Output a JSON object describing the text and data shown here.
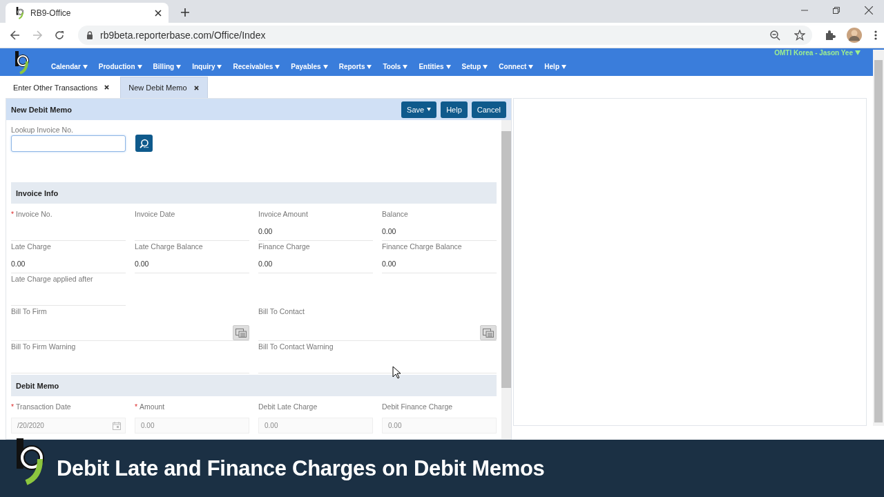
{
  "browser": {
    "tab_title": "RB9-Office",
    "url": "rb9beta.reporterbase.com/Office/Index"
  },
  "app": {
    "user_menu": "OMTI Korea - Jason Yee",
    "menu": [
      "Calendar",
      "Production",
      "Billing",
      "Inquiry",
      "Receivables",
      "Payables",
      "Reports",
      "Tools",
      "Entities",
      "Setup",
      "Connect",
      "Help"
    ],
    "tabs": [
      {
        "label": "Enter Other Transactions",
        "selected": false
      },
      {
        "label": "New Debit Memo",
        "selected": true
      }
    ]
  },
  "form": {
    "title": "New Debit Memo",
    "buttons": [
      {
        "label": "Save",
        "kind": "dropdown"
      },
      {
        "label": "Help",
        "kind": "plain"
      },
      {
        "label": "Cancel",
        "kind": "plain"
      }
    ],
    "lookup": {
      "label": "Lookup Invoice No."
    },
    "required_mark": "*",
    "sections": [
      {
        "title": "Invoice Info",
        "fields": [
          {
            "label": "Invoice No.",
            "required": true,
            "kind": "text"
          },
          {
            "label": "Invoice Date",
            "required": false,
            "kind": "text"
          },
          {
            "label": "Invoice Amount",
            "required": false,
            "kind": "text",
            "value": "0.00"
          },
          {
            "label": "Balance",
            "required": false,
            "kind": "text",
            "value": "0.00"
          },
          {
            "label": "Late Charge",
            "required": false,
            "kind": "text",
            "value": "0.00"
          },
          {
            "label": "Late Charge Balance",
            "required": false,
            "kind": "text",
            "value": "0.00"
          },
          {
            "label": "Finance Charge",
            "required": false,
            "kind": "text",
            "value": "0.00"
          },
          {
            "label": "Finance Charge Balance",
            "required": false,
            "kind": "text",
            "value": "0.00"
          },
          {
            "label": "Late Charge applied after",
            "required": false,
            "kind": "solo"
          },
          {
            "label": "Bill To Firm",
            "required": false,
            "kind": "picker"
          },
          {
            "label": "Bill To Contact",
            "required": false,
            "kind": "picker"
          },
          {
            "label": "Bill To Firm Warning",
            "required": false,
            "kind": "wide"
          },
          {
            "label": "Bill To Contact Warning",
            "required": false,
            "kind": "wide"
          }
        ]
      },
      {
        "title": "Debit Memo",
        "fields": [
          {
            "label": "Transaction Date",
            "required": true,
            "kind": "date",
            "value": "/20/2020"
          },
          {
            "label": "Amount",
            "required": true,
            "kind": "input",
            "value": "0.00"
          },
          {
            "label": "Debit Late Charge",
            "required": false,
            "kind": "input",
            "value": "0.00"
          },
          {
            "label": "Debit Finance Charge",
            "required": false,
            "kind": "input",
            "value": "0.00"
          }
        ]
      }
    ]
  },
  "caption": "Debit Late and Finance Charges on Debit Memos"
}
